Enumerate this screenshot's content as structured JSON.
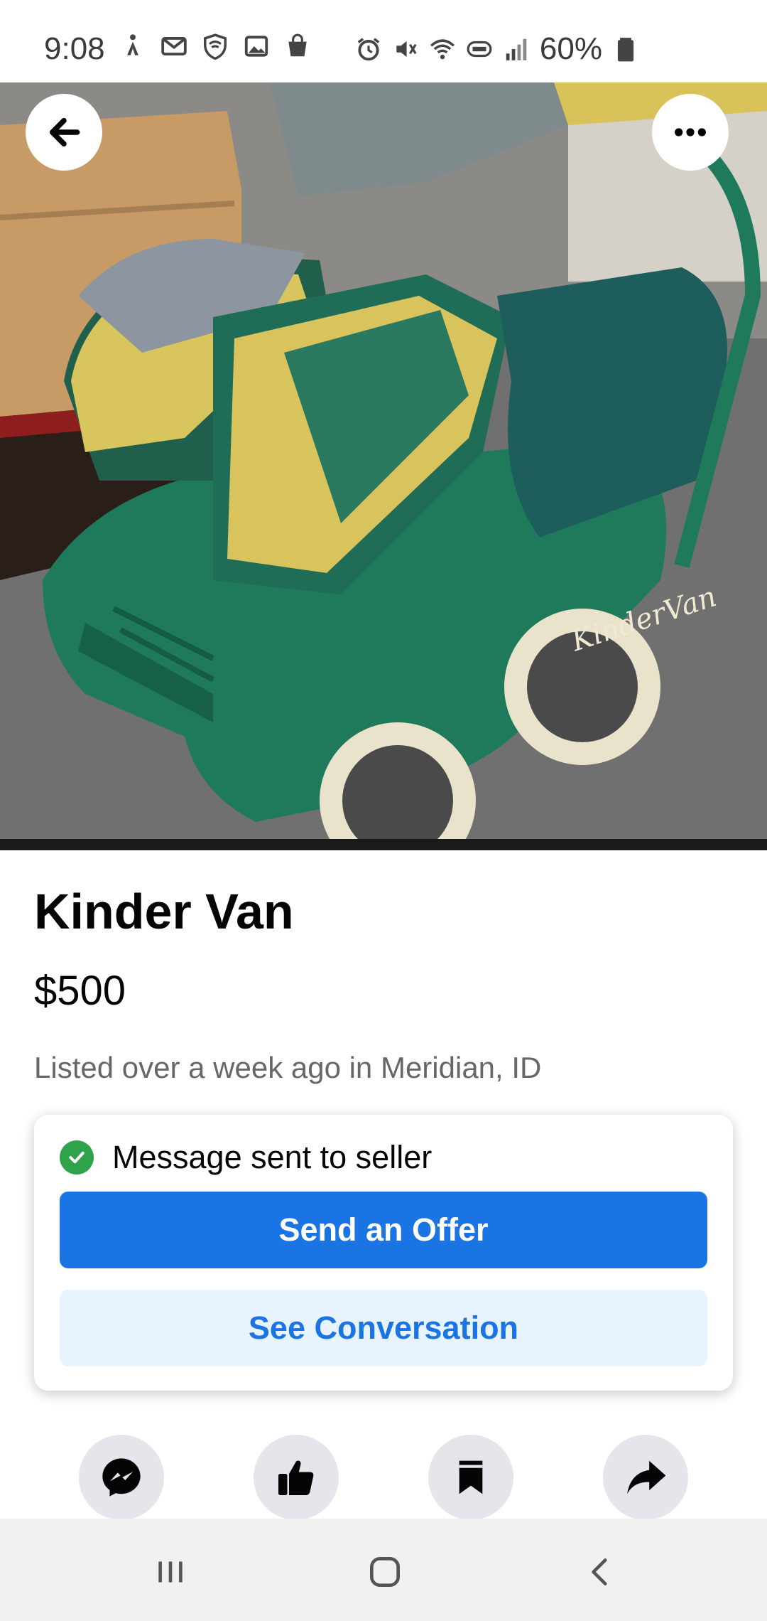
{
  "status_bar": {
    "time": "9:08",
    "battery": "60%",
    "left_icons": [
      "accessibility-icon",
      "gmail-icon",
      "shield-wifi-icon",
      "gallery-icon",
      "shopping-bag-icon"
    ],
    "right_icons": [
      "alarm-icon",
      "mute-icon",
      "wifi-icon",
      "volte-icon",
      "signal-icon",
      "battery-icon"
    ]
  },
  "listing": {
    "title": "Kinder Van",
    "price": "$500",
    "meta": "Listed over a week ago in Meridian, ID",
    "image_text": "KinderVan"
  },
  "seller_card": {
    "status_text": "Message sent to seller",
    "primary_button": "Send an Offer",
    "secondary_button": "See Conversation"
  },
  "actions": [
    "messenger-icon",
    "like-icon",
    "save-icon",
    "share-icon"
  ],
  "colors": {
    "accent": "#1b74e4",
    "accent_light": "#e7f3ff",
    "success": "#31a24c",
    "secondary_text": "#65676b",
    "stroller_green": "#1f7a5c",
    "stroller_yellow": "#d9c25a"
  }
}
